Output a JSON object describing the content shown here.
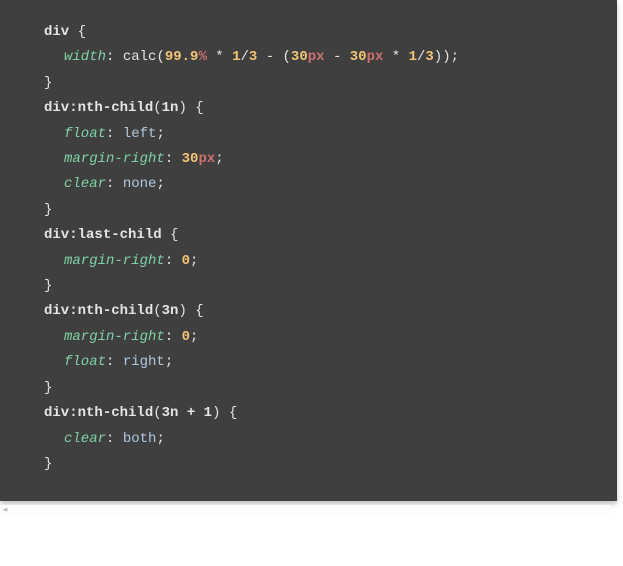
{
  "code": {
    "tokens": {
      "div": "div",
      "nth_child": ":nth-child",
      "last_child": ":last-child",
      "open_brace": " {",
      "close_brace": "}",
      "open_paren": "(",
      "close_paren": ")",
      "semicolon": ";",
      "colon": ": ",
      "width": "width",
      "float": "float",
      "margin_right": "margin-right",
      "clear": "clear",
      "calc": "calc",
      "left": "left",
      "right": "right",
      "none": "none",
      "both": "both",
      "n99_9": "99.9",
      "pct": "%",
      "star": " * ",
      "one": "1",
      "three": "3",
      "slash": "/",
      "minus": " - ",
      "thirty": "30",
      "px": "px",
      "zero": "0",
      "n1n": "1n",
      "n3n": "3n",
      "n3n1": "3n + 1"
    }
  }
}
